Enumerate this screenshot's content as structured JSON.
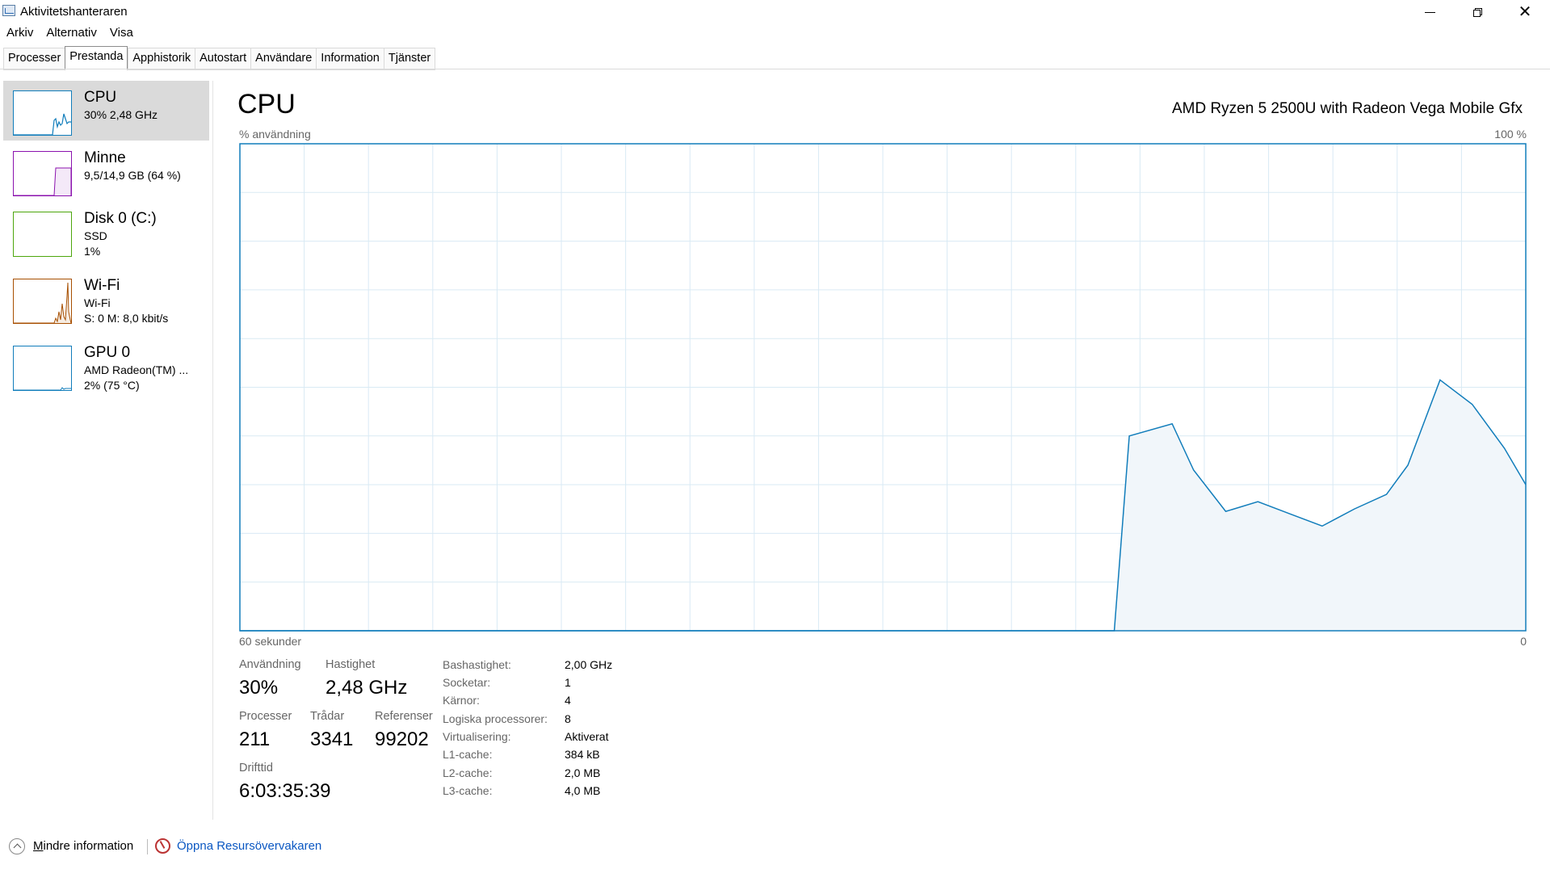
{
  "window": {
    "title": "Aktivitetshanteraren",
    "close_glyph": "✕"
  },
  "menu": [
    "Arkiv",
    "Alternativ",
    "Visa"
  ],
  "tabs": [
    "Processer",
    "Prestanda",
    "Apphistorik",
    "Autostart",
    "Användare",
    "Information",
    "Tjänster"
  ],
  "active_tab": "Prestanda",
  "sidebar": {
    "items": [
      {
        "title": "CPU",
        "line1": "30%  2,48 GHz",
        "line2": "",
        "line3": "",
        "color": "#117dbb"
      },
      {
        "title": "Minne",
        "line1": "9,5/14,9 GB (64 %)",
        "line2": "",
        "line3": "",
        "color": "#8b12ae"
      },
      {
        "title": "Disk 0 (C:)",
        "line1": "SSD",
        "line2": "1%",
        "line3": "",
        "color": "#4da60c"
      },
      {
        "title": "Wi-Fi",
        "line1": "Wi-Fi",
        "line2": "S: 0  M: 8,0 kbit/s",
        "line3": "",
        "color": "#a74f01"
      },
      {
        "title": "GPU 0",
        "line1": "AMD Radeon(TM) ...",
        "line2": "2%  (75 °C)",
        "line3": "",
        "color": "#117dbb"
      }
    ]
  },
  "main": {
    "title": "CPU",
    "processor_name": "AMD Ryzen 5 2500U with Radeon Vega Mobile Gfx",
    "axis_top_left": "% användning",
    "axis_top_right": "100 %",
    "axis_bottom_left": "60 sekunder",
    "axis_bottom_right": "0"
  },
  "chart_data": {
    "type": "area",
    "title": "CPU",
    "ylabel": "% användning",
    "xlabel": "60 sekunder",
    "ylim": [
      0,
      100
    ],
    "xlim": [
      60,
      0
    ],
    "color": "#117dbb",
    "fill": "#f1f6fa",
    "grid": true,
    "x": [
      60,
      19.2,
      18.5,
      16.5,
      15.5,
      14,
      12.5,
      11,
      9.5,
      8,
      6.5,
      5.5,
      4,
      2.5,
      1,
      0
    ],
    "values": [
      0,
      0,
      40,
      42.5,
      33,
      24.5,
      26.5,
      24,
      21.5,
      25,
      28,
      34,
      51.5,
      46.5,
      37.5,
      30
    ]
  },
  "stats": {
    "usage_label": "Användning",
    "usage_value": "30%",
    "speed_label": "Hastighet",
    "speed_value": "2,48 GHz",
    "processes_label": "Processer",
    "processes_value": "211",
    "threads_label": "Trådar",
    "threads_value": "3341",
    "handles_label": "Referenser",
    "handles_value": "99202",
    "uptime_label": "Drifttid",
    "uptime_value": "6:03:35:39"
  },
  "specs": [
    {
      "label": "Bashastighet:",
      "value": "2,00 GHz"
    },
    {
      "label": "Socketar:",
      "value": "1"
    },
    {
      "label": "Kärnor:",
      "value": "4"
    },
    {
      "label": "Logiska processorer:",
      "value": "8"
    },
    {
      "label": "Virtualisering:",
      "value": "Aktiverat"
    },
    {
      "label": "L1-cache:",
      "value": "384 kB"
    },
    {
      "label": "L2-cache:",
      "value": "2,0 MB"
    },
    {
      "label": "L3-cache:",
      "value": "4,0 MB"
    }
  ],
  "footer": {
    "less_info_underlined": "M",
    "less_info": "indre information",
    "resource_monitor": "Öppna Resursövervakaren"
  }
}
